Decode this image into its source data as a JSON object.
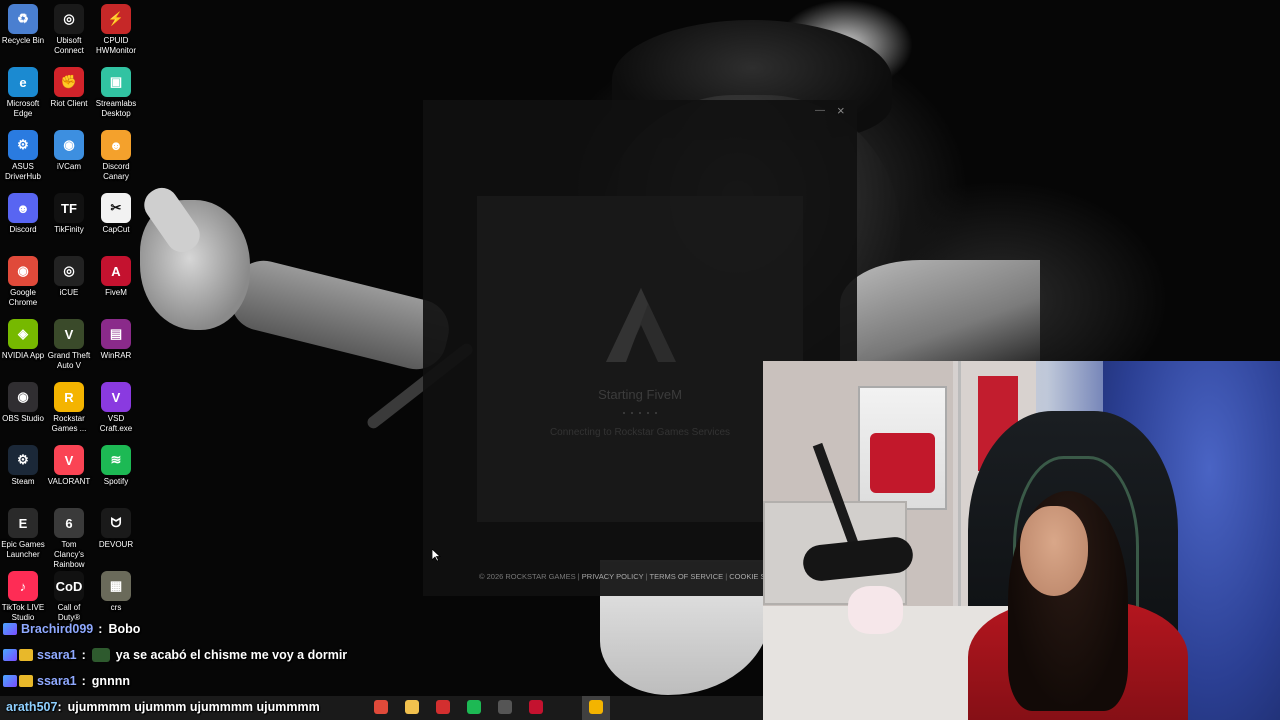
{
  "desktop": {
    "icons": [
      {
        "label": "Recycle Bin",
        "icon": "recycle-bin-icon",
        "color": "#4a7fd0",
        "glyph": "♻"
      },
      {
        "label": "Ubisoft Connect",
        "icon": "ubisoft-icon",
        "color": "#1a1a1a",
        "glyph": "◎"
      },
      {
        "label": "CPUID HWMonitor",
        "icon": "hwmonitor-icon",
        "color": "#c62828",
        "glyph": "⚡"
      },
      {
        "label": "Microsoft Edge",
        "icon": "edge-icon",
        "color": "#1b8ad1",
        "glyph": "e"
      },
      {
        "label": "Riot Client",
        "icon": "riot-icon",
        "color": "#d2232a",
        "glyph": "✊"
      },
      {
        "label": "Streamlabs Desktop",
        "icon": "streamlabs-icon",
        "color": "#31c3a2",
        "glyph": "▣"
      },
      {
        "label": "ASUS DriverHub",
        "icon": "asus-icon",
        "color": "#2a7be0",
        "glyph": "⚙"
      },
      {
        "label": "iVCam",
        "icon": "ivcam-icon",
        "color": "#3d8fe0",
        "glyph": "◉"
      },
      {
        "label": "Discord Canary",
        "icon": "discord-canary-icon",
        "color": "#f4a12c",
        "glyph": "☻"
      },
      {
        "label": "Discord",
        "icon": "discord-icon",
        "color": "#5865f2",
        "glyph": "☻"
      },
      {
        "label": "TikFinity",
        "icon": "tikfinity-icon",
        "color": "#111111",
        "glyph": "TF"
      },
      {
        "label": "CapCut",
        "icon": "capcut-icon",
        "color": "#f2f2f2",
        "glyph": "✂"
      },
      {
        "label": "Google Chrome",
        "icon": "chrome-icon",
        "color": "#e04a3a",
        "glyph": "◉"
      },
      {
        "label": "iCUE",
        "icon": "icue-icon",
        "color": "#222222",
        "glyph": "◎"
      },
      {
        "label": "FiveM",
        "icon": "fivem-icon",
        "color": "#c4122f",
        "glyph": "A"
      },
      {
        "label": "NVIDIA App",
        "icon": "nvidia-icon",
        "color": "#76b900",
        "glyph": "◈"
      },
      {
        "label": "Grand Theft Auto V",
        "icon": "gta-icon",
        "color": "#3a4a2a",
        "glyph": "V"
      },
      {
        "label": "WinRAR",
        "icon": "winrar-icon",
        "color": "#8a2a8a",
        "glyph": "▤"
      },
      {
        "label": "OBS Studio",
        "icon": "obs-icon",
        "color": "#302e31",
        "glyph": "◉"
      },
      {
        "label": "Rockstar Games ...",
        "icon": "rockstar-icon",
        "color": "#f4b400",
        "glyph": "R"
      },
      {
        "label": "VSD Craft.exe",
        "icon": "vsd-icon",
        "color": "#8a3ae0",
        "glyph": "V"
      },
      {
        "label": "Steam",
        "icon": "steam-icon",
        "color": "#1b2838",
        "glyph": "⚙"
      },
      {
        "label": "VALORANT",
        "icon": "valorant-icon",
        "color": "#fa4454",
        "glyph": "V"
      },
      {
        "label": "Spotify",
        "icon": "spotify-icon",
        "color": "#1db954",
        "glyph": "≋"
      },
      {
        "label": "Epic Games Launcher",
        "icon": "epic-icon",
        "color": "#2a2a2a",
        "glyph": "E"
      },
      {
        "label": "Tom Clancy's Rainbow Si...",
        "icon": "rainbow-six-icon",
        "color": "#3a3a3a",
        "glyph": "6"
      },
      {
        "label": "DEVOUR",
        "icon": "devour-icon",
        "color": "#1a1a1a",
        "glyph": "ᗢ"
      },
      {
        "label": "TikTok LIVE Studio",
        "icon": "tiktok-live-icon",
        "color": "#fe2c55",
        "glyph": "♪"
      },
      {
        "label": "Call of Duty®",
        "icon": "call-of-duty-icon",
        "color": "#111111",
        "glyph": "CoD"
      },
      {
        "label": "crs",
        "icon": "crs-icon",
        "color": "#6a6a5a",
        "glyph": "▦"
      }
    ]
  },
  "launcher": {
    "status": "Starting FiveM",
    "substatus": "Connecting to Rockstar Games Services",
    "footer_copyright": "© 2026 ROCKSTAR GAMES",
    "footer_privacy": "PRIVACY POLICY",
    "footer_terms": "TERMS OF SERVICE",
    "footer_cookie": "COOKIE S",
    "minimize_glyph": "—",
    "close_glyph": "×"
  },
  "chat": {
    "messages": [
      {
        "user": "Brachird099",
        "text": "Bobo"
      },
      {
        "user": "ssara1",
        "text": "ya se acabó el chisme me voy a dormir"
      },
      {
        "user": "ssara1",
        "text": "gnnnn"
      },
      {
        "user": "arath507",
        "text": "ujummmm ujummm ujummmm ujummmm"
      }
    ],
    "separator": ":"
  },
  "taskbar": {
    "icons": [
      {
        "name": "chrome-icon",
        "color": "#e04a3a"
      },
      {
        "name": "file-explorer-icon",
        "color": "#f2c14e"
      },
      {
        "name": "hwmonitor-icon",
        "color": "#d32f2f"
      },
      {
        "name": "spotify-icon",
        "color": "#1db954"
      },
      {
        "name": "obs-icon",
        "color": "#555555"
      },
      {
        "name": "fivem-icon",
        "color": "#c4122f"
      },
      {
        "name": "rockstar-icon",
        "color": "#f4b400"
      }
    ]
  }
}
